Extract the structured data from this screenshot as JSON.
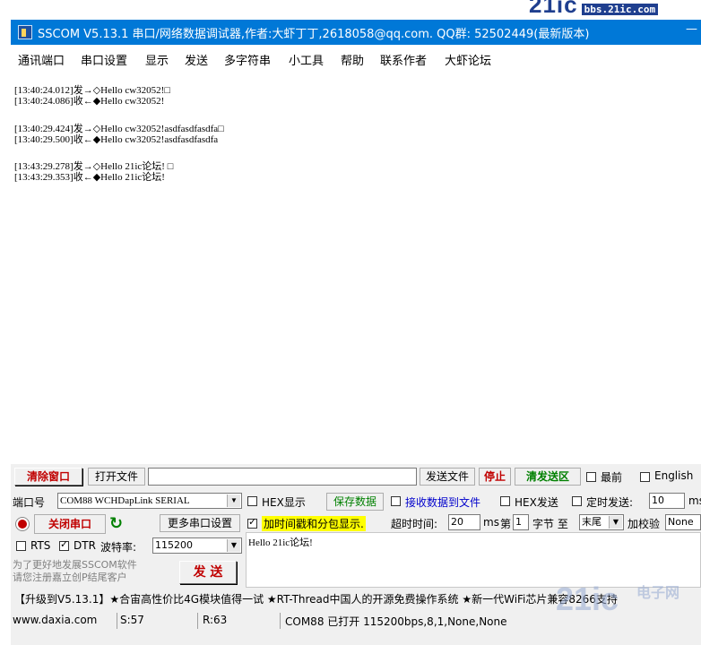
{
  "watermark_top": {
    "big": "21ic",
    "small": "bbs.21ic.com"
  },
  "window": {
    "title": "SSCOM V5.13.1 串口/网络数据调试器,作者:大虾丁丁,2618058@qq.com. QQ群: 52502449(最新版本)",
    "min_glyph": "—"
  },
  "menu": [
    "通讯端口",
    "串口设置",
    "显示",
    "发送",
    "多字符串",
    "小工具",
    "帮助",
    "联系作者",
    "大虾论坛"
  ],
  "log": [
    "[13:40:24.012]发→◇Hello cw32052!□",
    "[13:40:24.086]收←◆Hello cw32052!",
    "[13:40:29.424]发→◇Hello cw32052!asdfasdfasdfa□",
    "[13:40:29.500]收←◆Hello cw32052!asdfasdfasdfa",
    "[13:43:29.278]发→◇Hello 21ic论坛! □",
    "[13:43:29.353]收←◆Hello 21ic论坛!"
  ],
  "toolbar": {
    "clear_window": "清除窗口",
    "open_file": "打开文件",
    "send_file": "发送文件",
    "stop": "停止",
    "clear_send": "清发送区",
    "topmost": "最前",
    "english": "English"
  },
  "port": {
    "label": "端口号",
    "value": "COM88 WCHDapLink SERIAL",
    "hex_display": "HEX显示",
    "save_data": "保存数据",
    "recv_to_file": "接收数据到文件",
    "hex_send": "HEX发送",
    "timed_send": "定时发送:",
    "timed_value": "10",
    "timed_unit": "ms"
  },
  "row2": {
    "close_port": "关闭串口",
    "more_ports": "更多串口设置",
    "timestamp_label": "加时间戳和分包显示.",
    "timeout_label": "超时时间:",
    "timeout_value": "20",
    "timeout_unit": "ms",
    "nth_label": "第",
    "nth_value": "1",
    "byte_label": "字节 至",
    "end_value": "末尾",
    "checksum_label": "加校验",
    "checksum_value": "None"
  },
  "row3": {
    "rts": "RTS",
    "dtr": "DTR",
    "baud_label": "波特率:",
    "baud_value": "115200"
  },
  "send_text": "Hello 21ic论坛!",
  "promo": "为了更好地发展SSCOM软件\n请您注册嘉立创P结尾客户",
  "send_button": "发 送",
  "ticker": "【升级到V5.13.1】★合宙高性价比4G模块值得一试 ★RT-Thread中国人的开源免费操作系统 ★新一代WiFi芯片兼容8266支持",
  "status": {
    "site": "www.daxia.com",
    "sent": "S:57",
    "received": "R:63",
    "port_status": "COM88 已打开  115200bps,8,1,None,None"
  },
  "watermark_bottom": {
    "big": "21ic",
    "small": "电子网"
  },
  "colors": {
    "titlebar": "#0078d7",
    "accent_red": "#c00000",
    "accent_green": "#008000",
    "highlight_yellow": "#ffff00"
  }
}
